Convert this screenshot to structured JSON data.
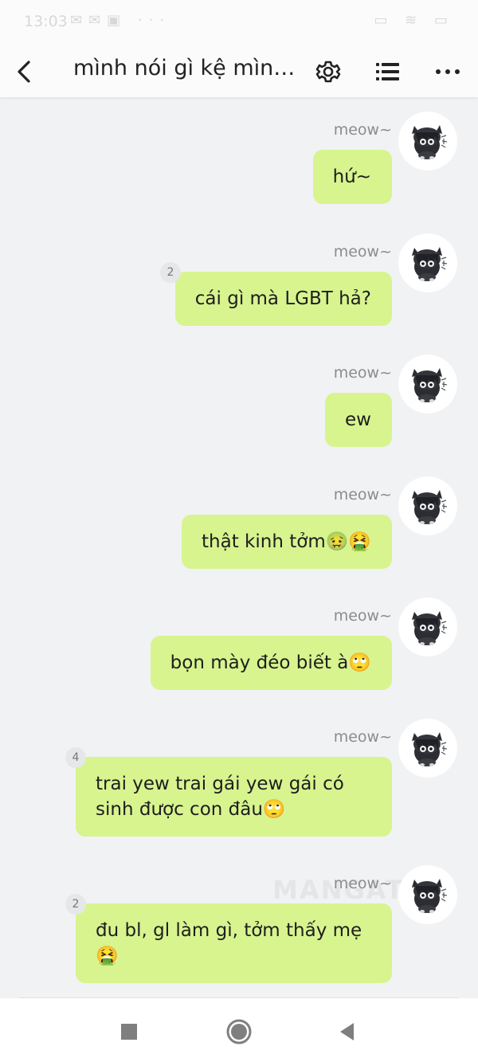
{
  "status_bar": {
    "time": "13:03"
  },
  "header": {
    "title": "mình nói gì kệ mình..."
  },
  "messages": [
    {
      "sender": "meow~",
      "text": "hứ~",
      "count": ""
    },
    {
      "sender": "meow~",
      "text": "cái gì mà LGBT hả?",
      "count": "2"
    },
    {
      "sender": "meow~",
      "text": "ew",
      "count": ""
    },
    {
      "sender": "meow~",
      "text": "thật kinh tởm🤢🤮",
      "count": ""
    },
    {
      "sender": "meow~",
      "text": "bọn mày đéo biết à🙄",
      "count": ""
    },
    {
      "sender": "meow~",
      "line1": "trai yew trai gái yew gái có",
      "line2": "sinh được con đâu🙄",
      "count": "4"
    },
    {
      "sender": "meow~",
      "line1": "đu bl, gl làm gì, tởm thấy mẹ",
      "line2": "🤮",
      "count": "2"
    }
  ],
  "watermark": "MANGATO",
  "colors": {
    "bubble": "#d8f48f",
    "background": "#f1f2f4",
    "sender": "#8c8c8c"
  }
}
